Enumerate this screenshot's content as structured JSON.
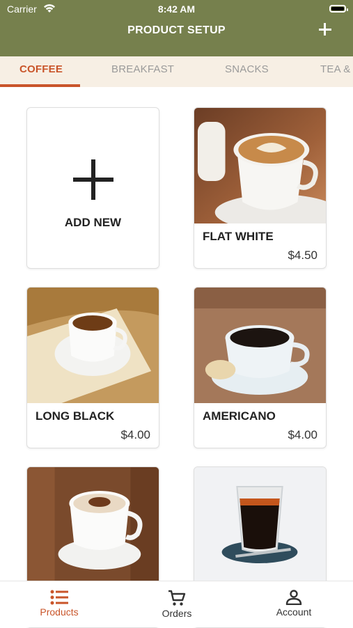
{
  "status_bar": {
    "carrier": "Carrier",
    "time": "8:42 AM"
  },
  "header": {
    "title": "PRODUCT SETUP"
  },
  "tabs": [
    {
      "label": "COFFEE",
      "active": true
    },
    {
      "label": "BREAKFAST",
      "active": false
    },
    {
      "label": "SNACKS",
      "active": false
    },
    {
      "label": "TEA &",
      "active": false
    }
  ],
  "add_new": {
    "label": "ADD NEW"
  },
  "products": [
    {
      "name": "FLAT WHITE",
      "price": "$4.50",
      "image": "latte-art-cup"
    },
    {
      "name": "LONG BLACK",
      "price": "$4.00",
      "image": "espresso-cup-on-book"
    },
    {
      "name": "AMERICANO",
      "price": "$4.00",
      "image": "black-coffee-cup"
    },
    {
      "name": "",
      "price": "",
      "image": "cappuccino-cup"
    },
    {
      "name": "",
      "price": "",
      "image": "espresso-glass"
    }
  ],
  "tab_bar": {
    "products": "Products",
    "orders": "Orders",
    "account": "Account"
  },
  "colors": {
    "header": "#76804d",
    "accent": "#c9552a",
    "tabs_bg": "#f7efe4"
  }
}
